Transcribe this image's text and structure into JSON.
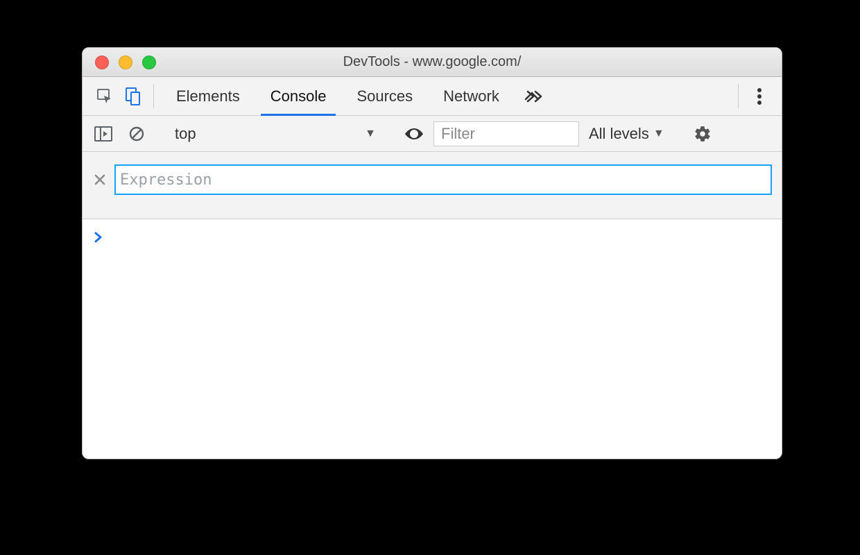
{
  "window": {
    "title": "DevTools - www.google.com/"
  },
  "tabs": {
    "items": [
      {
        "label": "Elements"
      },
      {
        "label": "Console"
      },
      {
        "label": "Sources"
      },
      {
        "label": "Network"
      }
    ],
    "active_index": 1
  },
  "toolbar": {
    "context": "top",
    "filter_placeholder": "Filter",
    "levels_label": "All levels"
  },
  "live_expression": {
    "placeholder": "Expression",
    "value": ""
  },
  "prompt": ">"
}
